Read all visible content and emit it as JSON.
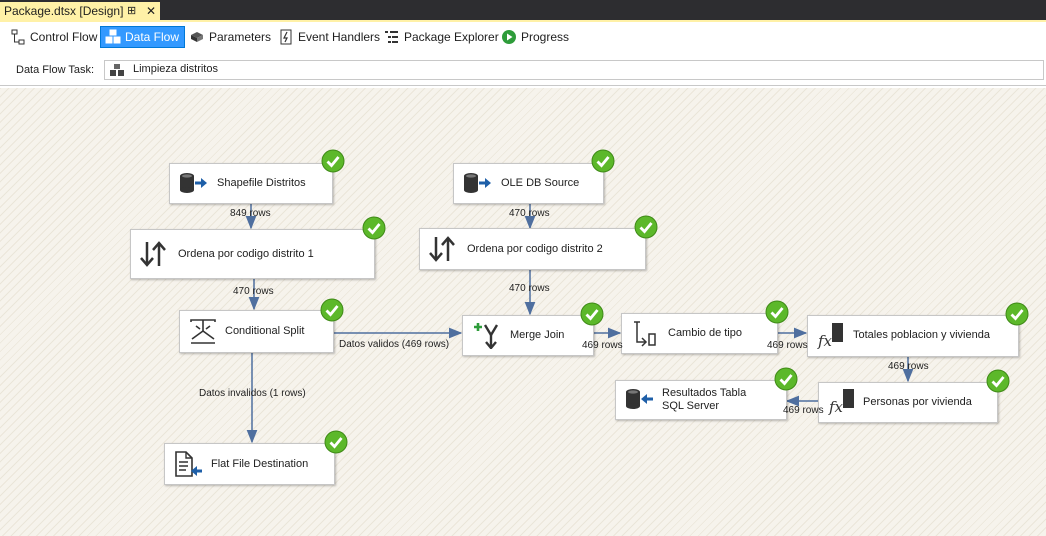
{
  "document_tab": {
    "title": "Package.dtsx [Design]",
    "pin_glyph": "⊞",
    "close_glyph": "✕"
  },
  "designer_tabs": [
    {
      "label": "Control Flow",
      "icon": "control-flow-icon",
      "active": false
    },
    {
      "label": "Data Flow",
      "icon": "data-flow-icon",
      "active": true
    },
    {
      "label": "Parameters",
      "icon": "parameters-icon",
      "active": false
    },
    {
      "label": "Event Handlers",
      "icon": "event-handlers-icon",
      "active": false
    },
    {
      "label": "Package Explorer",
      "icon": "package-explorer-icon",
      "active": false
    },
    {
      "label": "Progress",
      "icon": "progress-icon",
      "active": false
    }
  ],
  "task_selector": {
    "label": "Data Flow Task:",
    "value": "Limpieza distritos"
  },
  "components": {
    "shapefile_distritos": {
      "label": "Shapefile Distritos",
      "icon": "source-icon"
    },
    "ole_db_source": {
      "label": "OLE DB Source",
      "icon": "source-icon"
    },
    "ordena_1": {
      "label": "Ordena por codigo distrito 1",
      "icon": "sort-icon"
    },
    "ordena_2": {
      "label": "Ordena por codigo distrito 2",
      "icon": "sort-icon"
    },
    "conditional_split": {
      "label": "Conditional Split",
      "icon": "split-icon"
    },
    "merge_join": {
      "label": "Merge Join",
      "icon": "merge-join-icon"
    },
    "cambio_tipo": {
      "label": "Cambio de tipo",
      "icon": "data-conversion-icon"
    },
    "totales": {
      "label": "Totales poblacion y vivienda",
      "icon": "derived-column-icon"
    },
    "personas": {
      "label": "Personas por vivienda",
      "icon": "derived-column-icon"
    },
    "resultados": {
      "label_line1": "Resultados Tabla",
      "label_line2": "SQL Server",
      "icon": "destination-icon"
    },
    "flat_file": {
      "label": "Flat File Destination",
      "icon": "flat-file-destination-icon"
    }
  },
  "row_labels": {
    "shapefile_to_ordena1": "849 rows",
    "ole_to_ordena2": "470 rows",
    "ordena1_to_split": "470 rows",
    "ordena2_to_merge": "470 rows",
    "split_valid": "Datos validos (469 rows)",
    "split_invalid": "Datos invalidos (1 rows)",
    "merge_to_cambio": "469 rows",
    "cambio_to_totales": "469 rows",
    "totales_to_personas": "469 rows",
    "personas_to_resultados": "469 rows"
  },
  "colors": {
    "accent": "#3399ff",
    "tab_yellow": "#fff1a7",
    "arrow": "#4f6f9f",
    "success_green": "#5cb82a",
    "source_blue": "#1e5fa8"
  }
}
